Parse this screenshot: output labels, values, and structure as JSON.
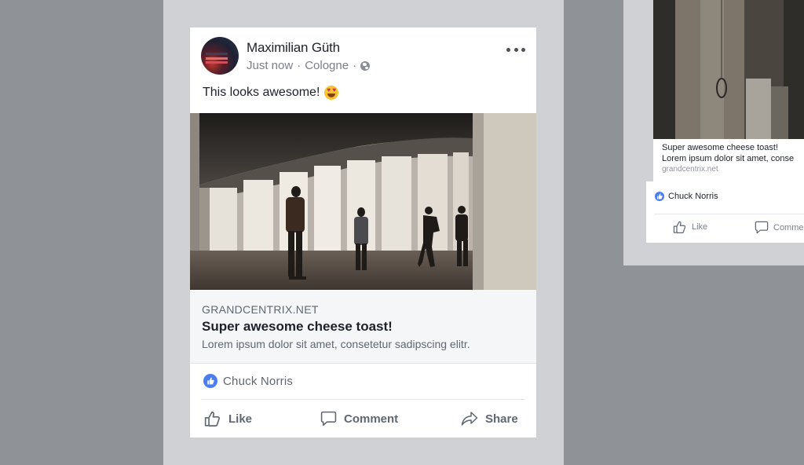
{
  "post": {
    "author": "Maximilian Güth",
    "time": "Just now",
    "location": "Cologne",
    "separator": "·",
    "privacy_icon": "globe-icon",
    "more_icon": "more-options-icon",
    "status_text": "This looks awesome!",
    "status_emoji": "heart-eyes-emoji"
  },
  "link_preview": {
    "domain": "GRANDCENTRIX.NET",
    "title": "Super awesome cheese toast!",
    "description": "Lorem ipsum dolor sit amet, consetetur sadipscing elitr."
  },
  "reactions": {
    "icon": "thumbs-up-icon",
    "names": "Chuck Norris"
  },
  "actions": {
    "like": "Like",
    "comment": "Comment",
    "share": "Share"
  },
  "side_card": {
    "title": "Super awesome cheese toast!",
    "description": "Lorem ipsum dolor sit amet, conse",
    "domain": "grandcentrix.net",
    "reaction_name": "Chuck Norris",
    "like": "Like",
    "comment": "Comme"
  },
  "colors": {
    "background": "#8f9297",
    "panel": "#cfd1d5",
    "accent_blue": "#4a7ef0",
    "text_primary": "#1d2129",
    "text_secondary": "#606770"
  }
}
